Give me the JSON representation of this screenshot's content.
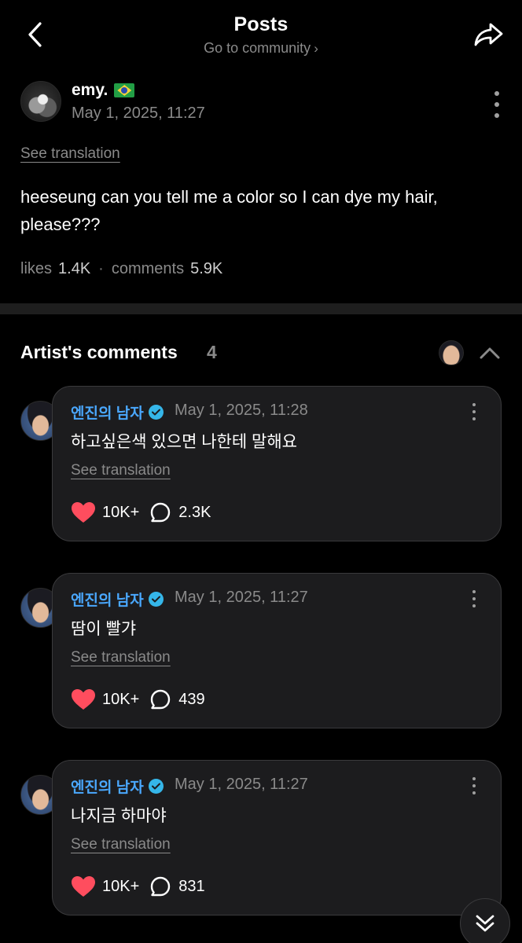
{
  "header": {
    "title": "Posts",
    "subtitle": "Go to community",
    "subtitle_chevron": "›",
    "back_icon": "chevron-left-icon",
    "share_icon": "share-arrow-icon"
  },
  "post": {
    "author": "emy.",
    "author_flag": "brazil-flag",
    "date": "May 1, 2025, 11:27",
    "see_translation": "See translation",
    "body": "heeseung can you tell me a color so I can dye my hair, please???",
    "likes_label": "likes",
    "likes_value": "1.4K",
    "separator": "·",
    "comments_label": "comments",
    "comments_value": "5.9K"
  },
  "artist_comments": {
    "title": "Artist's comments",
    "count": "4",
    "items": [
      {
        "author": "엔진의 남자",
        "date": "May 1, 2025, 11:28",
        "text": "하고싶은색 있으면 나한테 말해요",
        "see_translation": "See translation",
        "likes": "10K+",
        "comments": "2.3K"
      },
      {
        "author": "엔진의 남자",
        "date": "May 1, 2025, 11:27",
        "text": "땀이 빨갸",
        "see_translation": "See translation",
        "likes": "10K+",
        "comments": "439"
      },
      {
        "author": "엔진의 남자",
        "date": "May 1, 2025, 11:27",
        "text": "나지금 하마야",
        "see_translation": "See translation",
        "likes": "10K+",
        "comments": "831"
      }
    ]
  },
  "colors": {
    "background": "#000000",
    "card": "#1c1c1e",
    "artist_name": "#4aa8ff",
    "verified": "#35b6e9",
    "heart": "#ff4d5e",
    "muted_text": "#8a8a8a"
  }
}
